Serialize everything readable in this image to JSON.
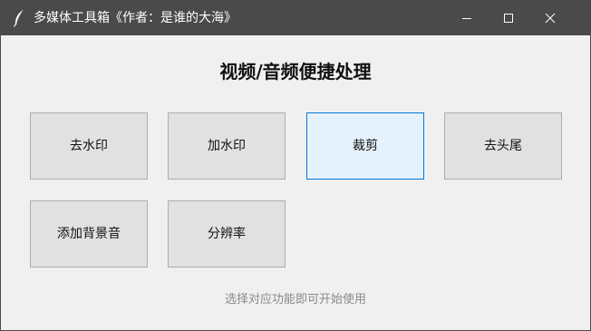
{
  "window": {
    "title": "多媒体工具箱《作者：是谁的大海》",
    "app_icon": "feather-icon",
    "controls": [
      "minimize-icon",
      "maximize-icon",
      "close-icon"
    ]
  },
  "main": {
    "heading": "视频/音频便捷处理",
    "buttons": [
      {
        "label": "去水印",
        "active": false
      },
      {
        "label": "加水印",
        "active": false
      },
      {
        "label": "裁剪",
        "active": true
      },
      {
        "label": "去头尾",
        "active": false
      },
      {
        "label": "添加背景音",
        "active": false
      },
      {
        "label": "分辨率",
        "active": false
      }
    ],
    "hint": "选择对应功能即可开始使用"
  },
  "colors": {
    "titlebar_bg": "#4a4a4a",
    "window_bg": "#f0f0f0",
    "button_bg": "#e1e1e1",
    "button_border": "#adadad",
    "active_bg": "#e5f1fb",
    "active_border": "#0078d7",
    "hint_text": "#8a8a8a"
  }
}
